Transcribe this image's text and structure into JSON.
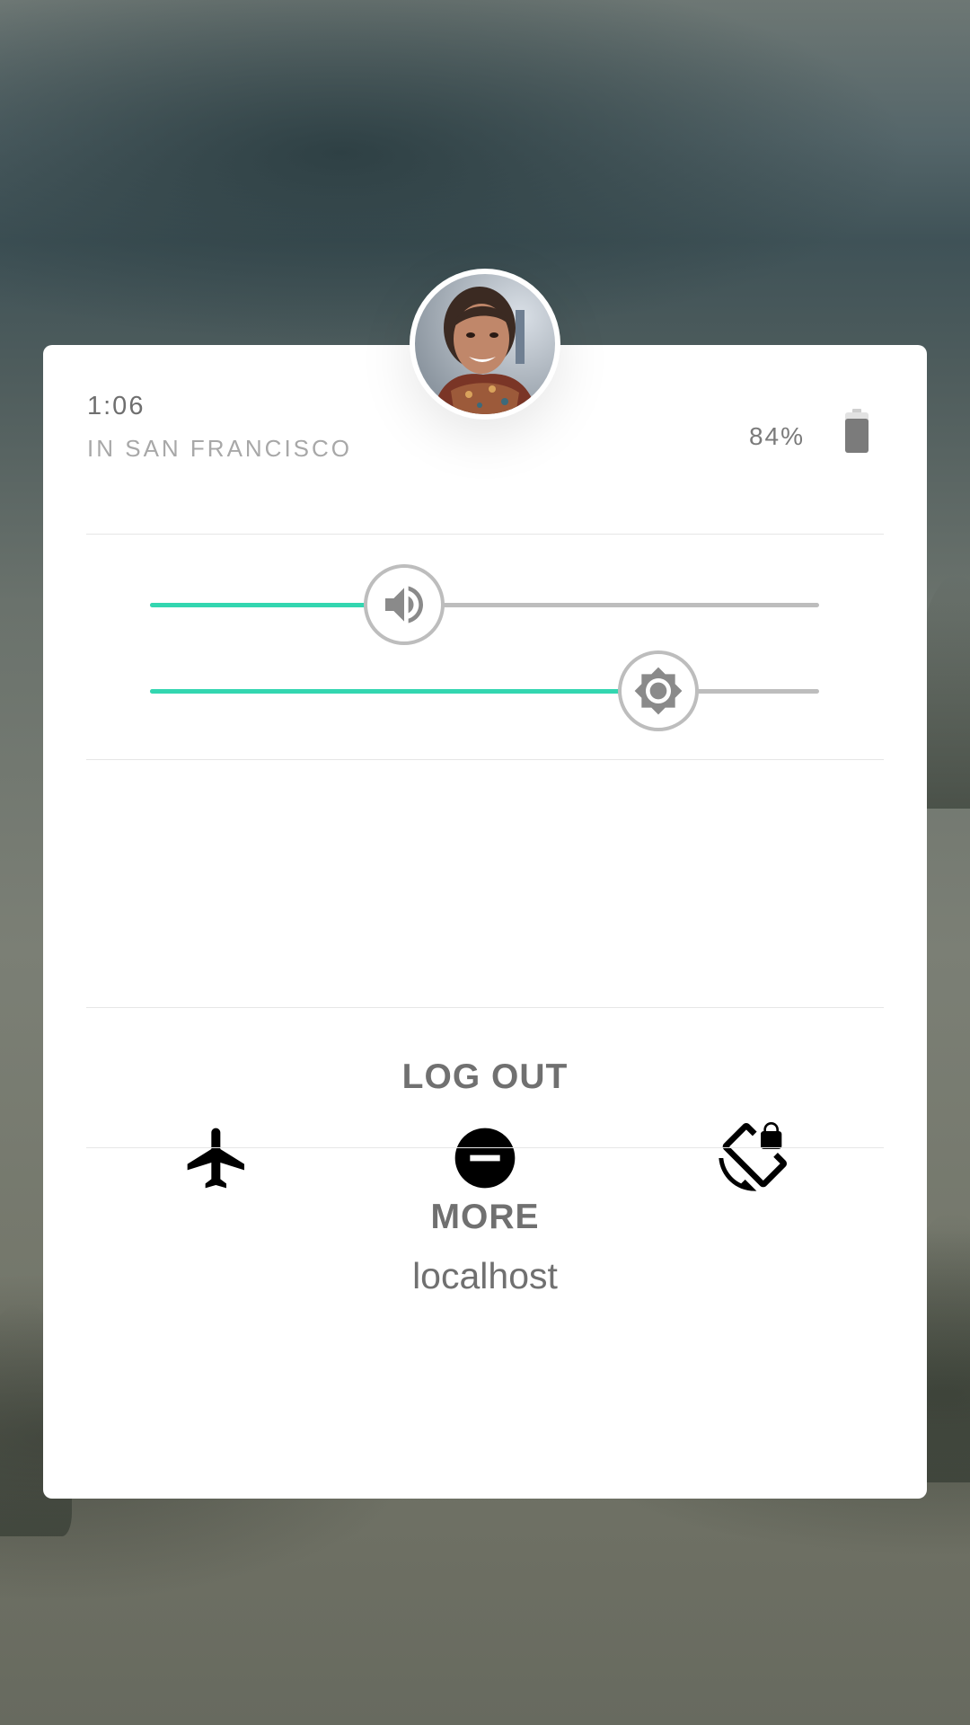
{
  "status": {
    "time": "1:06",
    "location": "IN SAN FRANCISCO",
    "battery_percent": "84%",
    "battery_level": 0.84
  },
  "sliders": {
    "volume": {
      "icon": "volume-icon",
      "level": 0.38
    },
    "brightness": {
      "icon": "brightness-icon",
      "level": 0.76
    }
  },
  "toggles": [
    {
      "icon": "airplane-icon"
    },
    {
      "icon": "do-not-disturb-icon"
    },
    {
      "icon": "rotation-lock-icon"
    }
  ],
  "network": {
    "name": "localhost"
  },
  "actions": {
    "logout_label": "LOG OUT",
    "more_label": "MORE"
  },
  "colors": {
    "accent": "#33d6b0",
    "track": "#bdbdbd",
    "card": "#ffffff",
    "text": "#707070"
  }
}
